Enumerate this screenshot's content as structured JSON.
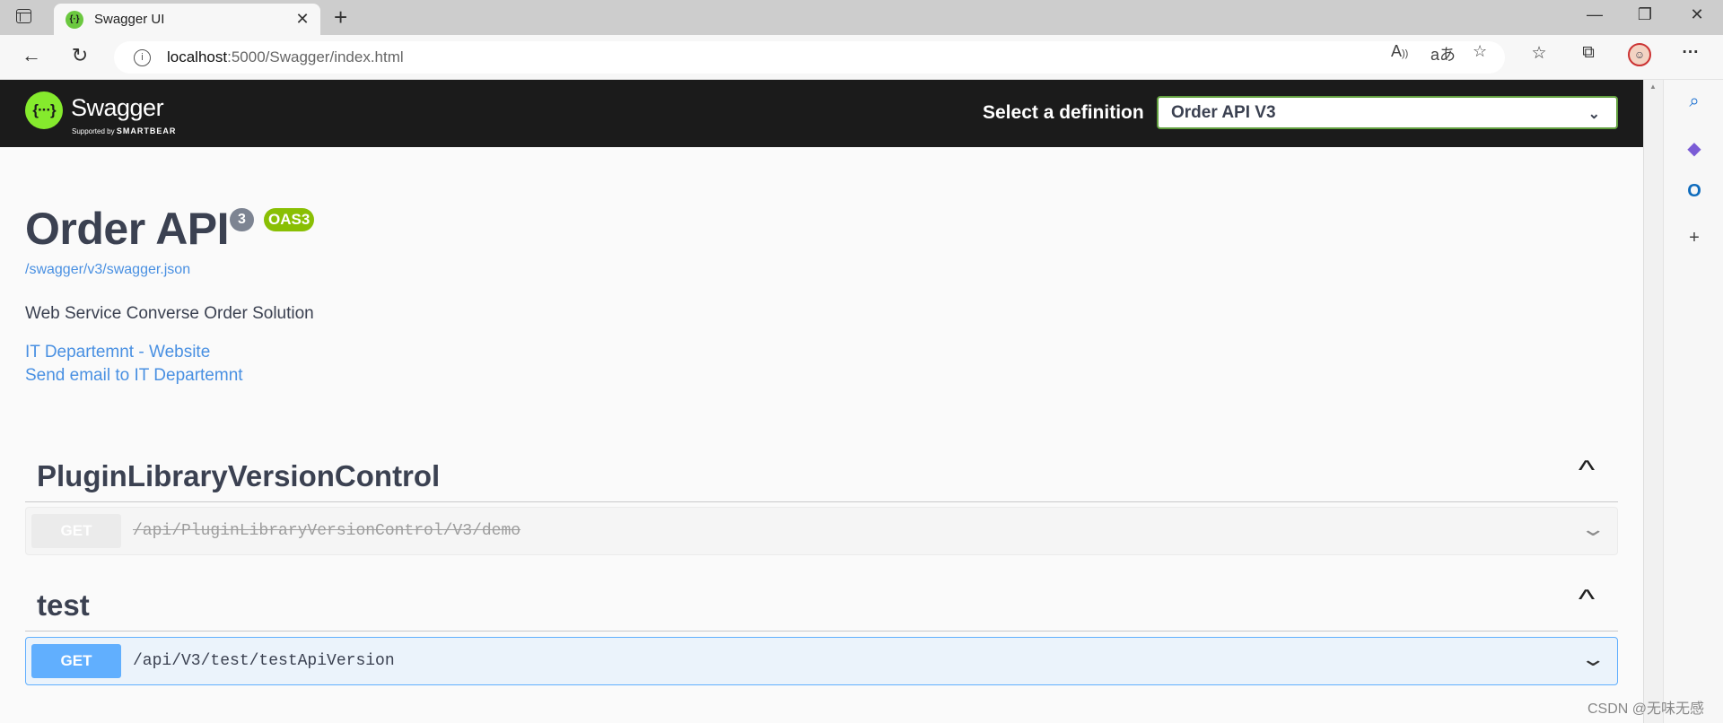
{
  "browser": {
    "tab_title": "Swagger UI",
    "tab_close": "✕",
    "new_tab": "+",
    "url_host": "localhost",
    "url_path": ":5000/Swagger/index.html",
    "window_controls": {
      "minimize": "—",
      "maximize": "❐",
      "close": "✕"
    }
  },
  "header": {
    "logo_text": "Swagger",
    "logo_sub_prefix": "Supported by",
    "logo_sub_brand": "SMARTBEAR",
    "select_label": "Select a definition",
    "selected_definition": "Order API V3"
  },
  "info": {
    "title": "Order API",
    "version_badge": "3",
    "spec_badge": "OAS3",
    "spec_url": "/swagger/v3/swagger.json",
    "description": "Web Service Converse Order Solution",
    "links": [
      "IT Departemnt - Website",
      "Send email to IT Departemnt"
    ]
  },
  "tags": [
    {
      "name": "PluginLibraryVersionControl",
      "operations": [
        {
          "method": "GET",
          "path": "/api/PluginLibraryVersionControl/V3/demo",
          "deprecated": true
        }
      ]
    },
    {
      "name": "test",
      "operations": [
        {
          "method": "GET",
          "path": "/api/V3/test/testApiVersion",
          "deprecated": false
        }
      ]
    }
  ],
  "watermark": "CSDN @无味无感",
  "colors": {
    "topbar": "#1b1b1b",
    "logo_green": "#85ea2d",
    "get_blue": "#61affe",
    "oas_green": "#89bf04",
    "link_blue": "#4990e2"
  }
}
